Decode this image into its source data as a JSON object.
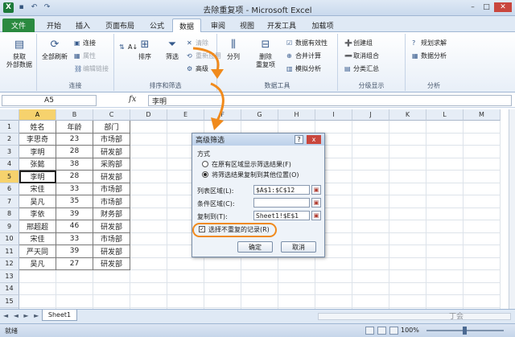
{
  "titlebar": {
    "title": "去除重复项 - Microsoft Excel"
  },
  "tabs": {
    "file": "文件",
    "items": [
      "开始",
      "插入",
      "页面布局",
      "公式",
      "数据",
      "审阅",
      "视图",
      "开发工具",
      "加载项"
    ],
    "active": 4
  },
  "ribbon": {
    "g1": {
      "label": "",
      "btn": "获取\n外部数据"
    },
    "g2": {
      "label": "连接",
      "refresh": "全部刷新",
      "conn": "连接",
      "props": "属性",
      "links": "编辑链接"
    },
    "g3": {
      "label": "排序和筛选",
      "az": "A↓",
      "sort": "排序",
      "filter": "筛选",
      "clear": "清除",
      "reapply": "重新应用",
      "advanced": "高级"
    },
    "g4": {
      "label": "数据工具",
      "split": "分列",
      "dedupe": "删除\n重复项",
      "validation": "数据有效性",
      "consolidate": "合并计算",
      "whatif": "模拟分析"
    },
    "g5": {
      "label": "分级显示",
      "group": "创建组",
      "ungroup": "取消组合",
      "subtotal": "分类汇总"
    },
    "g6": {
      "label": "分析",
      "solver": "规划求解",
      "analysis": "数据分析"
    }
  },
  "formula": {
    "namebox": "A5",
    "fx": "fx",
    "value": "李明"
  },
  "columns": [
    "A",
    "B",
    "C",
    "D",
    "E",
    "F",
    "G",
    "H",
    "I",
    "J",
    "K",
    "L",
    "M"
  ],
  "rows": [
    "1",
    "2",
    "3",
    "4",
    "5",
    "6",
    "7",
    "8",
    "9",
    "10",
    "11",
    "12",
    "13",
    "14",
    "15",
    "16"
  ],
  "table": [
    [
      "姓名",
      "年龄",
      "部门"
    ],
    [
      "李思奇",
      "23",
      "市场部"
    ],
    [
      "李明",
      "28",
      "研发部"
    ],
    [
      "张懿",
      "38",
      "采购部"
    ],
    [
      "李明",
      "28",
      "研发部"
    ],
    [
      "宋佳",
      "33",
      "市场部"
    ],
    [
      "吴凡",
      "35",
      "市场部"
    ],
    [
      "李依",
      "39",
      "财务部"
    ],
    [
      "邢超超",
      "46",
      "研发部"
    ],
    [
      "宋佳",
      "33",
      "市场部"
    ],
    [
      "严天同",
      "39",
      "研发部"
    ],
    [
      "吴凡",
      "27",
      "研发部"
    ]
  ],
  "dialog": {
    "title": "高级筛选",
    "q": "?",
    "x": "x",
    "mode": "方式",
    "opt1": "在原有区域显示筛选结果(F)",
    "opt2": "将筛选结果复制到其他位置(O)",
    "list_label": "列表区域(L):",
    "list_value": "$A$1:$C$12",
    "crit_label": "条件区域(C):",
    "crit_value": "",
    "copy_label": "复制到(T):",
    "copy_value": "Sheet1!$E$1",
    "unique": "选择不重复的记录(R)",
    "ok": "确定",
    "cancel": "取消"
  },
  "sheet": {
    "name": "Sheet1",
    "nav": "◄ ◄ ► ►"
  },
  "status": {
    "ready": "就绪",
    "zoom": "100%"
  },
  "watermark": "丁会",
  "colors": {
    "accent": "#f08a1c",
    "selected_header": "#f6d26d",
    "file_tab": "#2a8a3f"
  }
}
